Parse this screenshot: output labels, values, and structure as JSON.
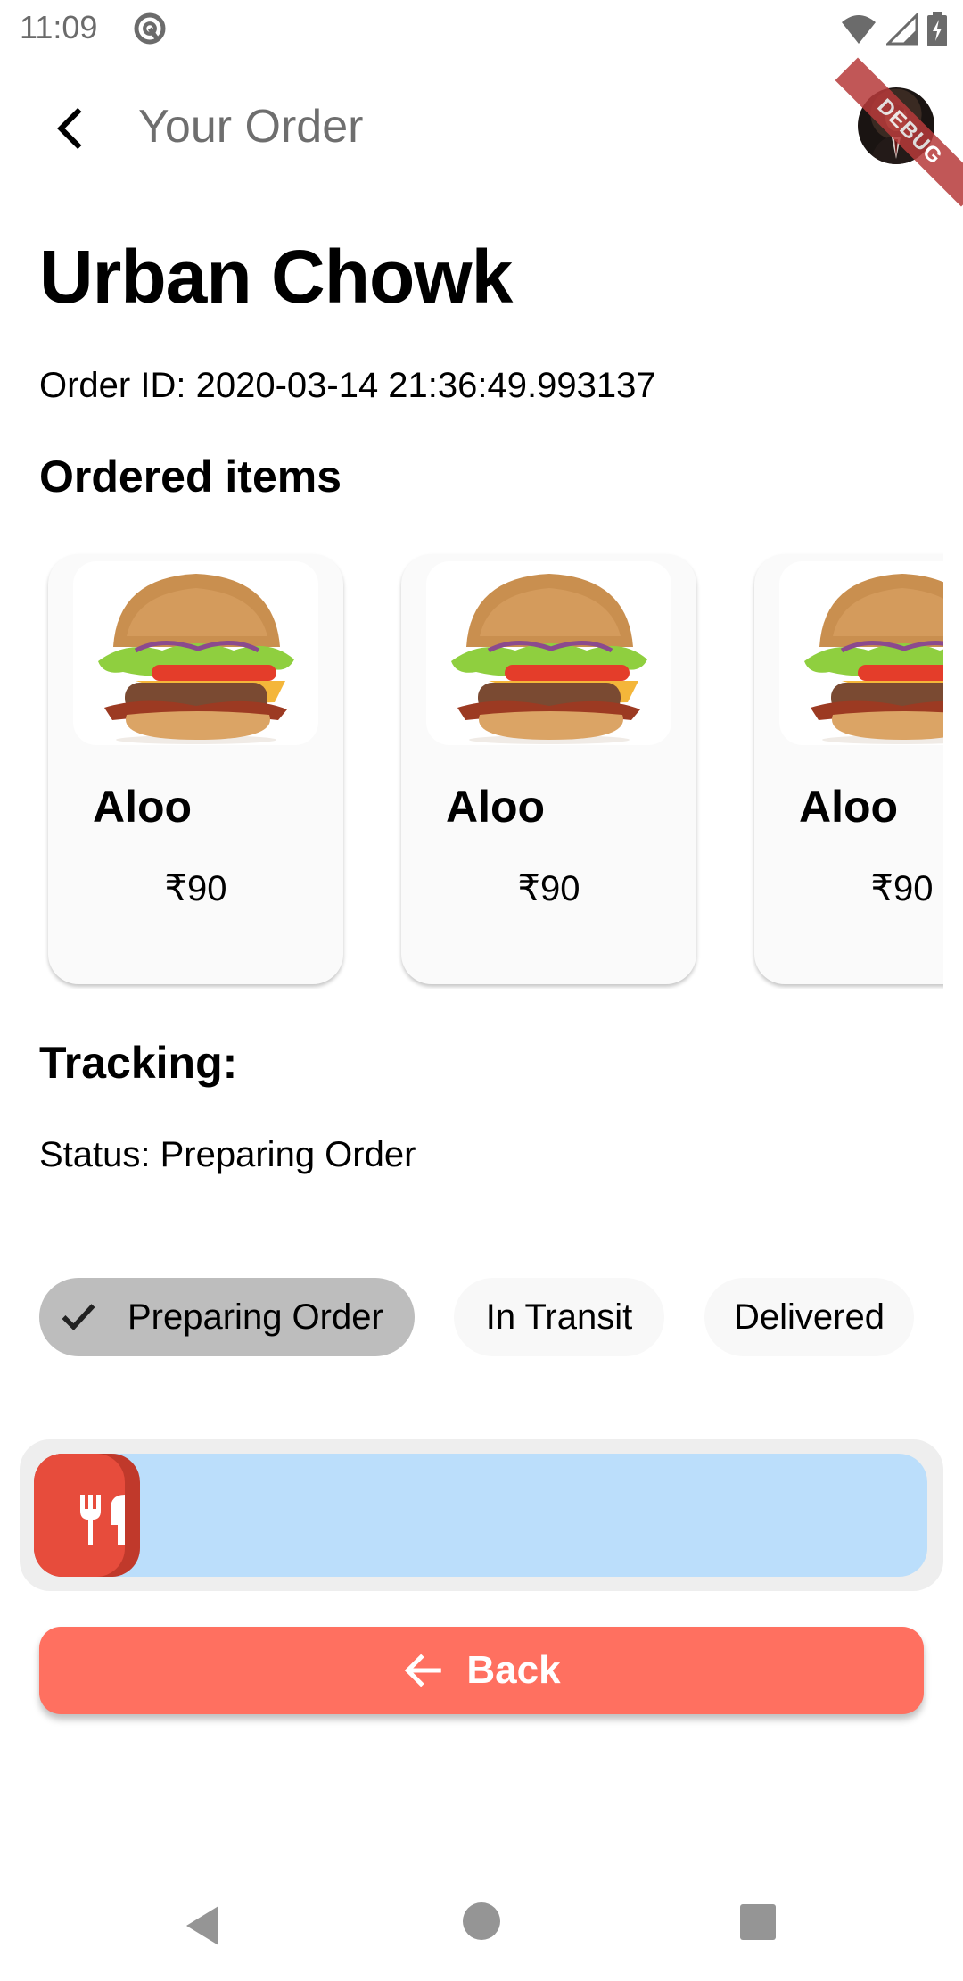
{
  "status_bar": {
    "time": "11:09",
    "icons": [
      "at-sign-icon",
      "wifi-icon",
      "signal-icon",
      "battery-charging-icon"
    ]
  },
  "app_bar": {
    "title": "Your Order",
    "back_icon": "chevron-left-icon",
    "avatar": "user-avatar",
    "debug_banner": "DEBUG"
  },
  "order": {
    "restaurant": "Urban Chowk",
    "order_id": "Order ID: 2020-03-14 21:36:49.993137",
    "items_heading": "Ordered items",
    "items": [
      {
        "name": "Aloo",
        "price": "₹90",
        "image": "burger-image"
      },
      {
        "name": "Aloo",
        "price": "₹90",
        "image": "burger-image"
      },
      {
        "name": "Aloo",
        "price": "₹90",
        "image": "burger-image"
      }
    ]
  },
  "tracking": {
    "heading": "Tracking:",
    "status": "Status: Preparing Order",
    "chips": [
      {
        "label": "Preparing Order",
        "selected": true
      },
      {
        "label": "In Transit",
        "selected": false
      },
      {
        "label": "Delivered",
        "selected": false
      }
    ],
    "slider": {
      "progress": 0,
      "knob_icon": "restaurant-icon"
    }
  },
  "colors": {
    "accent": "#ff7060",
    "knob": "#e74c3c",
    "knob_shadow": "#c0392b",
    "track": "#bbdefb",
    "chip_selected": "#bdbdbd"
  },
  "back_button": {
    "label": "Back",
    "icon": "arrow-left-icon"
  },
  "nav_bar": {
    "buttons": [
      "nav-back",
      "nav-home",
      "nav-recents"
    ]
  }
}
